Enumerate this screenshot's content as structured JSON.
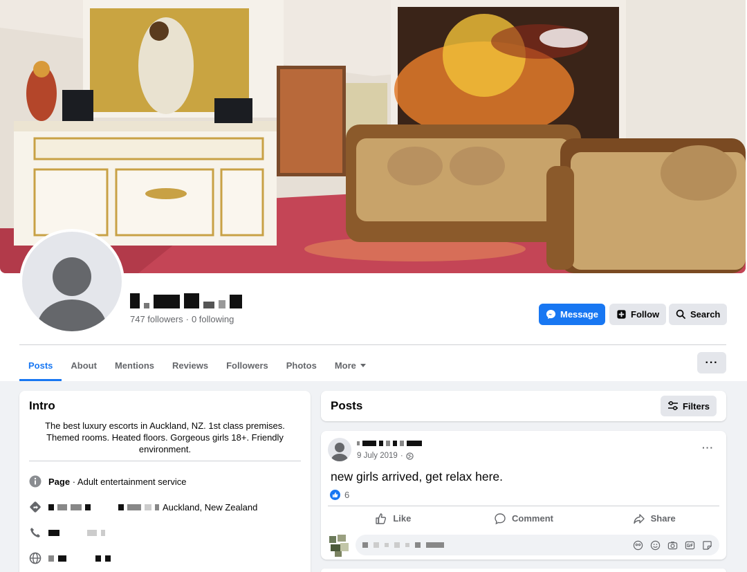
{
  "profile": {
    "followers_text": "747 followers",
    "separator": "·",
    "following_text": "0 following"
  },
  "actions": {
    "message": "Message",
    "follow": "Follow",
    "search": "Search"
  },
  "tabs": [
    {
      "label": "Posts",
      "active": true
    },
    {
      "label": "About"
    },
    {
      "label": "Mentions"
    },
    {
      "label": "Reviews"
    },
    {
      "label": "Followers"
    },
    {
      "label": "Photos"
    },
    {
      "label": "More"
    }
  ],
  "more_dots": "···",
  "intro": {
    "title": "Intro",
    "bio": "The best luxury escorts in Auckland, NZ. 1st class premises. Themed rooms. Heated floors. Gorgeous girls 18+. Friendly environment.",
    "page_label": "Page",
    "page_category": " · Adult entertainment service",
    "address_suffix": "Auckland, New Zealand"
  },
  "posts_section": {
    "title": "Posts",
    "filters_label": "Filters"
  },
  "post": {
    "date": "9 July 2019",
    "dot": "·",
    "text": "new girls arrived, get relax here.",
    "reaction_count": "6",
    "like_label": "Like",
    "comment_label": "Comment",
    "share_label": "Share",
    "dots": "···"
  },
  "colors": {
    "accent": "#1877f2",
    "background": "#f0f2f5",
    "button_grey": "#e4e6eb",
    "text_secondary": "#65676b"
  }
}
